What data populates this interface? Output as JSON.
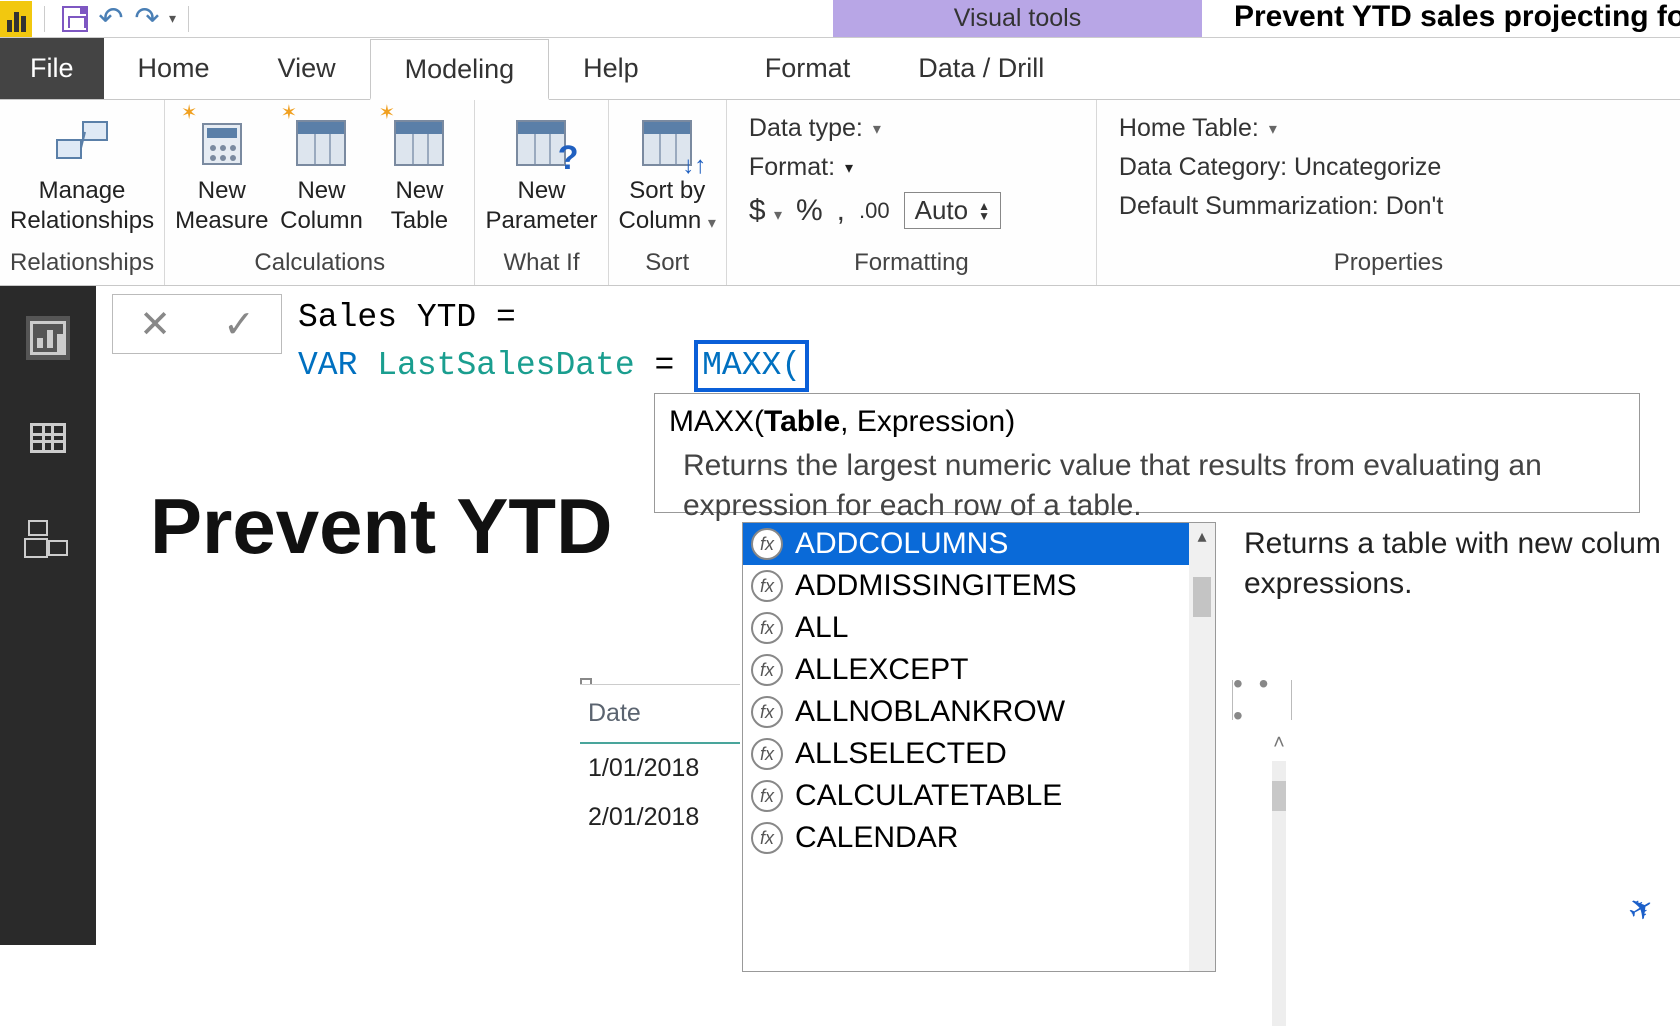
{
  "app": {
    "contextual_tab": "Visual tools",
    "title": "Prevent YTD sales projecting forwa"
  },
  "tabs": {
    "file": "File",
    "home": "Home",
    "view": "View",
    "modeling": "Modeling",
    "help": "Help",
    "format": "Format",
    "data_drill": "Data / Drill"
  },
  "ribbon": {
    "relationships_group": "Relationships",
    "manage_relationships": "Manage\nRelationships",
    "calculations_group": "Calculations",
    "new_measure": "New\nMeasure",
    "new_column": "New\nColumn",
    "new_table": "New\nTable",
    "whatif_group": "What If",
    "new_parameter": "New\nParameter",
    "sort_group": "Sort",
    "sort_by_column": "Sort by\nColumn",
    "formatting_group": "Formatting",
    "data_type_label": "Data type:",
    "format_label": "Format:",
    "currency_symbol": "$",
    "percent_symbol": "%",
    "comma_symbol": ",",
    "auto_value": "Auto",
    "properties_group": "Properties",
    "home_table_label": "Home Table:",
    "data_category_label": "Data Category: Uncategorize",
    "default_summ_label": "Default Summarization: Don't"
  },
  "formula": {
    "line1_a": "Sales YTD = ",
    "var_kw": "VAR",
    "var_name": "LastSalesDate",
    "equals": " = ",
    "func": "MAXX(",
    "tooltip_prefix": "MAXX(",
    "tooltip_bold": "Table",
    "tooltip_suffix": ", Expression)",
    "tooltip_desc": "Returns the largest numeric value that results from evaluating an expression for each row of a table."
  },
  "intellisense": {
    "items": [
      "ADDCOLUMNS",
      "ADDMISSINGITEMS",
      "ALL",
      "ALLEXCEPT",
      "ALLNOBLANKROW",
      "ALLSELECTED",
      "CALCULATETABLE",
      "CALENDAR"
    ],
    "selected_tip": "Returns a table with new colum expressions."
  },
  "canvas": {
    "headline": "Prevent YTD"
  },
  "table": {
    "header": "Date",
    "rows": [
      "1/01/2018",
      "2/01/2018"
    ]
  },
  "misc": {
    "dots": "• • •",
    "x": "✕",
    "check": "✓"
  }
}
